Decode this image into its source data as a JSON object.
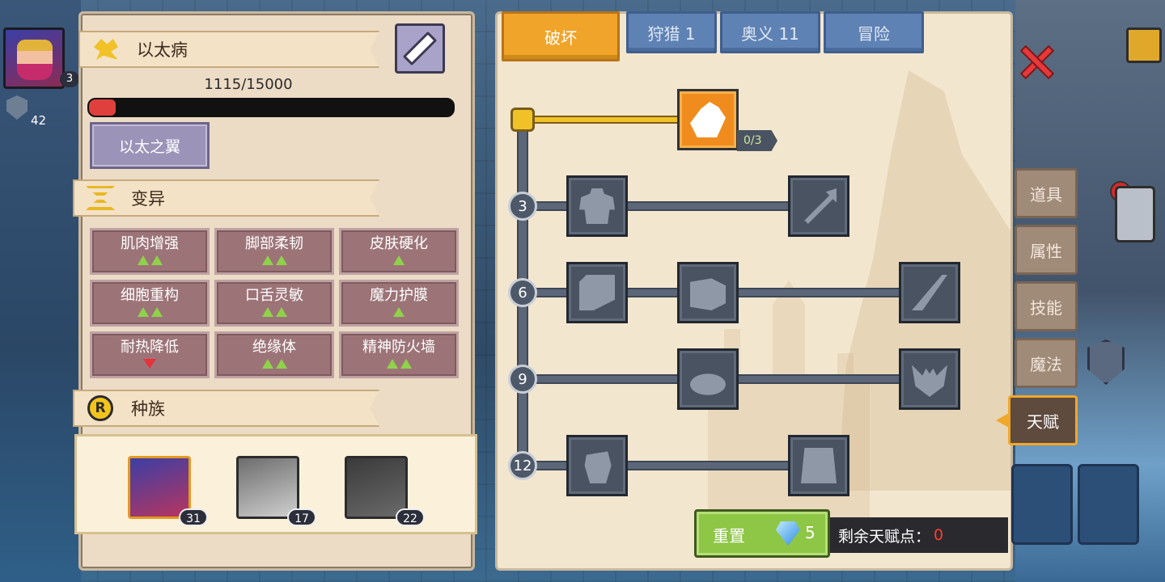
{
  "hero": {
    "level": "3",
    "shield_count": "42"
  },
  "left": {
    "disease": {
      "title": "以太病",
      "progress_text": "1115/15000",
      "progress": 0.0743,
      "wing_label": "以太之翼"
    },
    "mutation": {
      "title": "变异",
      "items": [
        {
          "name": "肌肉增强",
          "up": 2,
          "down": 0
        },
        {
          "name": "脚部柔韧",
          "up": 2,
          "down": 0
        },
        {
          "name": "皮肤硬化",
          "up": 1,
          "down": 0
        },
        {
          "name": "细胞重构",
          "up": 2,
          "down": 0
        },
        {
          "name": "口舌灵敏",
          "up": 2,
          "down": 0
        },
        {
          "name": "魔力护膜",
          "up": 1,
          "down": 0
        },
        {
          "name": "耐热降低",
          "up": 0,
          "down": 1
        },
        {
          "name": "绝缘体",
          "up": 2,
          "down": 0
        },
        {
          "name": "精神防火墙",
          "up": 2,
          "down": 0
        }
      ]
    },
    "race": {
      "title": "种族",
      "members": [
        {
          "level": "31",
          "selected": true
        },
        {
          "level": "17",
          "selected": false
        },
        {
          "level": "22",
          "selected": false
        }
      ]
    }
  },
  "tabs": [
    {
      "label": "破坏",
      "active": true
    },
    {
      "label": "狩猎 1",
      "active": false
    },
    {
      "label": "奥义 11",
      "active": false
    },
    {
      "label": "冒险",
      "active": false
    }
  ],
  "tree": {
    "tiers": [
      "3",
      "6",
      "9",
      "12"
    ],
    "top_skill_count": "0/3",
    "skills": [
      {
        "icon": "arm-wrestle-icon",
        "active": true
      },
      {
        "icon": "muscle-body-icon",
        "active": false
      },
      {
        "icon": "arrow-branch-icon",
        "active": false
      },
      {
        "icon": "card-break-icon",
        "active": false
      },
      {
        "icon": "punch-icon",
        "active": false
      },
      {
        "icon": "slash-splash-icon",
        "active": false
      },
      {
        "icon": "orb-ripple-icon",
        "active": false
      },
      {
        "icon": "bat-wing-icon",
        "active": false
      },
      {
        "icon": "raised-fist-icon",
        "active": false
      },
      {
        "icon": "fist-wall-icon",
        "active": false
      }
    ]
  },
  "reset": {
    "label": "重置",
    "cost": "5"
  },
  "remaining": {
    "label": "剩余天赋点：",
    "value": "0"
  },
  "side_tabs": [
    {
      "label": "道具",
      "active": false
    },
    {
      "label": "属性",
      "active": false
    },
    {
      "label": "技能",
      "active": false
    },
    {
      "label": "魔法",
      "active": false
    },
    {
      "label": "天赋",
      "active": true
    }
  ],
  "colors": {
    "accent": "#f0a42a",
    "tab_blue": "#5f82b4",
    "mut_bg": "#9c7478",
    "up": "#8fd24a",
    "down": "#e8313a"
  }
}
